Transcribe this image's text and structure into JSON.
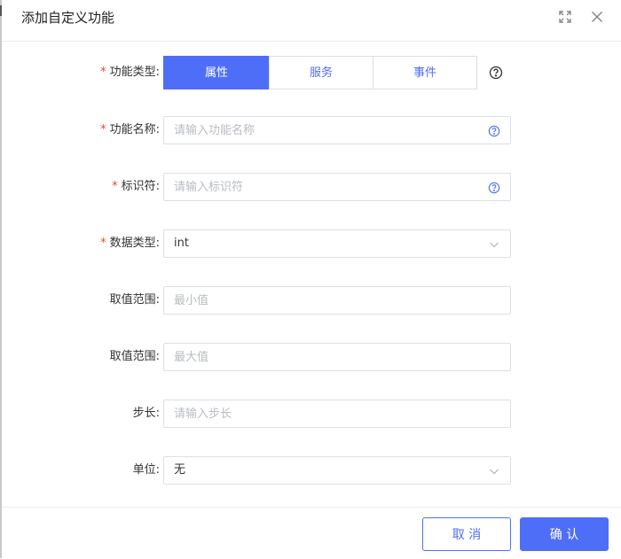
{
  "dialog": {
    "title": "添加自定义功能",
    "icons": {
      "fullscreen": "fullscreen-icon",
      "close": "close-icon"
    }
  },
  "form": {
    "function_type": {
      "label": "功能类型:",
      "required": true,
      "options": [
        "属性",
        "服务",
        "事件"
      ],
      "selected": "属性",
      "help_icon": "question-circle-icon"
    },
    "function_name": {
      "label": "功能名称:",
      "required": true,
      "value": "",
      "placeholder": "请输入功能名称",
      "help_icon": "question-circle-icon"
    },
    "identifier": {
      "label": "标识符:",
      "required": true,
      "value": "",
      "placeholder": "请输入标识符",
      "help_icon": "question-circle-icon"
    },
    "data_type": {
      "label": "数据类型:",
      "required": true,
      "value": "int",
      "icon": "chevron-down-icon"
    },
    "range_min": {
      "label": "取值范围:",
      "required": false,
      "value": "",
      "placeholder": "最小值"
    },
    "range_max": {
      "label": "取值范围:",
      "required": false,
      "value": "",
      "placeholder": "最大值"
    },
    "step": {
      "label": "步长:",
      "required": false,
      "value": "",
      "placeholder": "请输入步长"
    },
    "unit": {
      "label": "单位:",
      "required": false,
      "value": "无",
      "icon": "chevron-down-icon"
    }
  },
  "footer": {
    "cancel_label": "取 消",
    "ok_label": "确 认"
  },
  "colors": {
    "primary": "#4f6ef7",
    "required_star": "#f04134",
    "border": "#dcdfe6",
    "placeholder": "#b8bcc4"
  },
  "required_mark": "*"
}
